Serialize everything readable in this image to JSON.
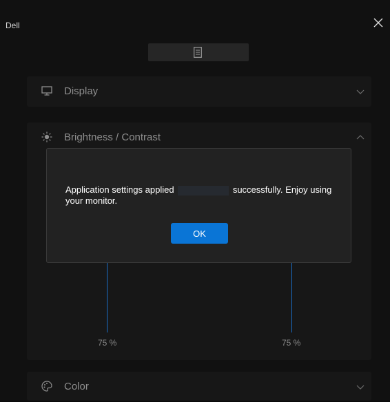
{
  "app": {
    "title": "Dell"
  },
  "sections": {
    "display": {
      "label": "Display"
    },
    "brightness": {
      "label": "Brightness / Contrast",
      "brightness_value": "75 %",
      "contrast_value": "75 %"
    },
    "color": {
      "label": "Color"
    }
  },
  "dialog": {
    "message_part1": "Application settings applied",
    "message_part2": "successfully. Enjoy using your monitor.",
    "ok_label": "OK"
  },
  "colors": {
    "accent": "#0a75d6",
    "slider": "#1b6fc7",
    "background": "#111111"
  }
}
